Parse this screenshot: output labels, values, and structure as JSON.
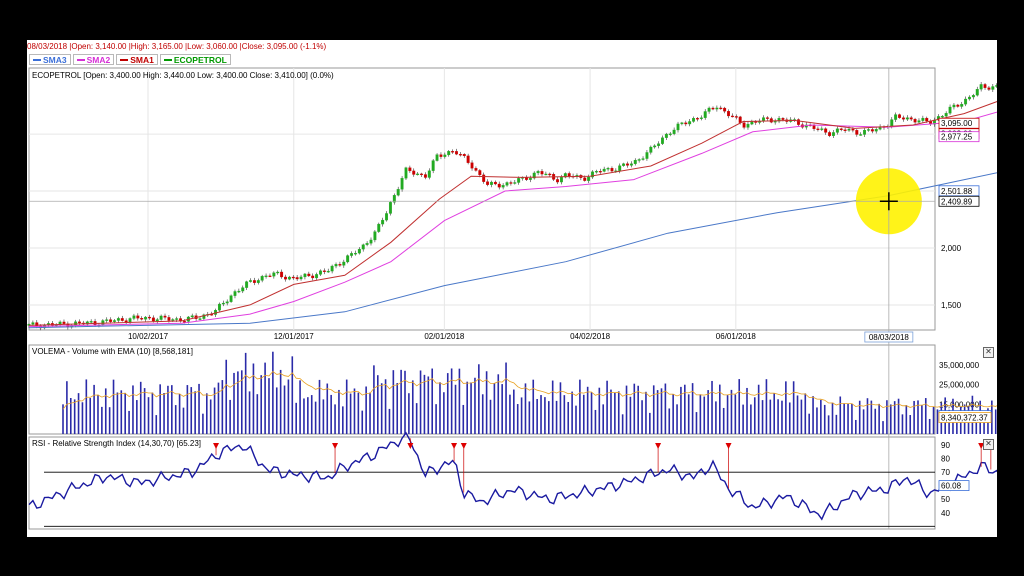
{
  "cursor_info": "08/03/2018 |Open: 3,140.00 |High: 3,165.00 |Low: 3,060.00 |Close: 3,095.00 (-1.1%)",
  "legend": [
    {
      "name": "SMA3",
      "color": "#3b6fd8"
    },
    {
      "name": "SMA2",
      "color": "#d62fd6"
    },
    {
      "name": "SMA1",
      "color": "#c00000"
    },
    {
      "name": "ECOPETROL",
      "color": "#009900"
    }
  ],
  "colors": {
    "up": "#22aa22",
    "down": "#cc0000",
    "sma3": "#4a78c8",
    "sma2": "#e040e0",
    "sma1": "#c03030",
    "volume": "#2a2aa8",
    "ema": "#e8a020",
    "rsi": "#1a1aa0",
    "crosshair": "#aaaaaa",
    "highlight": "#fff200"
  },
  "chart_data": [
    {
      "type": "candlestick",
      "title": "ECOPETROL [Open: 3,400.00  High: 3,440.00  Low: 3,400.00  Close: 3,410.00] (0.0%)",
      "x_ticks": [
        "10/02/2017",
        "12/01/2017",
        "02/01/2018",
        "04/02/2018",
        "06/01/2018"
      ],
      "cursor_x_label": "08/03/2018",
      "y_ticks": [
        1500,
        2000,
        2500,
        3000
      ],
      "ylim": [
        1280,
        3580
      ],
      "x_range": [
        "2017-08-14",
        "2018-08-22"
      ],
      "value_labels": [
        {
          "text": "3,095.00",
          "value": 3095,
          "color": "#c00000"
        },
        {
          "text": "3,003.00",
          "value": 3003,
          "color": "#c00000"
        },
        {
          "text": "2,977.25",
          "value": 2977,
          "color": "#d62fd6"
        },
        {
          "text": "2,501.88",
          "value": 2502,
          "color": "#3b6fd8"
        },
        {
          "text": "2,409.89",
          "value": 2410,
          "color": "#000000"
        }
      ],
      "price_keypoints": [
        [
          "2017-08-14",
          1320
        ],
        [
          "2017-08-28",
          1330
        ],
        [
          "2017-09-11",
          1345
        ],
        [
          "2017-09-25",
          1380
        ],
        [
          "2017-10-02",
          1385
        ],
        [
          "2017-10-16",
          1370
        ],
        [
          "2017-10-23",
          1390
        ],
        [
          "2017-10-30",
          1450
        ],
        [
          "2017-11-06",
          1600
        ],
        [
          "2017-11-13",
          1700
        ],
        [
          "2017-11-20",
          1760
        ],
        [
          "2017-11-24",
          1770
        ],
        [
          "2017-12-01",
          1730
        ],
        [
          "2017-12-08",
          1760
        ],
        [
          "2017-12-15",
          1800
        ],
        [
          "2017-12-22",
          1900
        ],
        [
          "2017-12-29",
          2000
        ],
        [
          "2018-01-04",
          2150
        ],
        [
          "2018-01-08",
          2300
        ],
        [
          "2018-01-10",
          2400
        ],
        [
          "2018-01-16",
          2680
        ],
        [
          "2018-01-24",
          2630
        ],
        [
          "2018-01-29",
          2800
        ],
        [
          "2018-02-05",
          2860
        ],
        [
          "2018-02-12",
          2730
        ],
        [
          "2018-02-19",
          2550
        ],
        [
          "2018-02-26",
          2560
        ],
        [
          "2018-03-05",
          2600
        ],
        [
          "2018-03-12",
          2670
        ],
        [
          "2018-03-19",
          2600
        ],
        [
          "2018-03-23",
          2640
        ],
        [
          "2018-03-30",
          2610
        ],
        [
          "2018-04-06",
          2680
        ],
        [
          "2018-04-13",
          2700
        ],
        [
          "2018-04-20",
          2750
        ],
        [
          "2018-04-27",
          2860
        ],
        [
          "2018-05-04",
          3010
        ],
        [
          "2018-05-11",
          3100
        ],
        [
          "2018-05-18",
          3160
        ],
        [
          "2018-05-24",
          3250
        ],
        [
          "2018-05-28",
          3190
        ],
        [
          "2018-06-04",
          3080
        ],
        [
          "2018-06-11",
          3120
        ],
        [
          "2018-06-18",
          3130
        ],
        [
          "2018-06-25",
          3110
        ],
        [
          "2018-07-02",
          3060
        ],
        [
          "2018-07-09",
          3010
        ],
        [
          "2018-07-16",
          3040
        ],
        [
          "2018-07-23",
          3010
        ],
        [
          "2018-07-30",
          3050
        ],
        [
          "2018-08-03",
          3095
        ],
        [
          "2018-08-06",
          3150
        ],
        [
          "2018-08-13",
          3130
        ],
        [
          "2018-08-20",
          3100
        ],
        [
          "2018-08-27",
          3200
        ],
        [
          "2018-09-03",
          3290
        ],
        [
          "2018-09-10",
          3410
        ],
        [
          "2018-09-17",
          3420
        ],
        [
          "2018-09-21",
          3410
        ]
      ],
      "sma1_keypoints": [
        [
          "2017-08-14",
          1320
        ],
        [
          "2017-10-16",
          1360
        ],
        [
          "2017-11-13",
          1500
        ],
        [
          "2017-12-01",
          1680
        ],
        [
          "2017-12-22",
          1760
        ],
        [
          "2018-01-10",
          2050
        ],
        [
          "2018-01-30",
          2430
        ],
        [
          "2018-02-12",
          2630
        ],
        [
          "2018-03-05",
          2620
        ],
        [
          "2018-04-02",
          2630
        ],
        [
          "2018-04-27",
          2720
        ],
        [
          "2018-05-18",
          2920
        ],
        [
          "2018-06-04",
          3110
        ],
        [
          "2018-06-25",
          3120
        ],
        [
          "2018-07-20",
          3050
        ],
        [
          "2018-08-13",
          3080
        ],
        [
          "2018-09-03",
          3180
        ],
        [
          "2018-09-21",
          3320
        ]
      ],
      "sma2_keypoints": [
        [
          "2017-08-14",
          1310
        ],
        [
          "2017-10-16",
          1340
        ],
        [
          "2017-11-13",
          1420
        ],
        [
          "2017-12-01",
          1530
        ],
        [
          "2017-12-22",
          1700
        ],
        [
          "2018-01-10",
          1880
        ],
        [
          "2018-02-01",
          2240
        ],
        [
          "2018-02-26",
          2500
        ],
        [
          "2018-03-23",
          2540
        ],
        [
          "2018-04-20",
          2600
        ],
        [
          "2018-05-18",
          2830
        ],
        [
          "2018-06-08",
          3020
        ],
        [
          "2018-07-02",
          3080
        ],
        [
          "2018-08-03",
          3060
        ],
        [
          "2018-09-03",
          3110
        ],
        [
          "2018-09-21",
          3220
        ]
      ],
      "sma3_keypoints": [
        [
          "2017-08-14",
          1300
        ],
        [
          "2017-11-13",
          1340
        ],
        [
          "2017-12-22",
          1440
        ],
        [
          "2018-02-01",
          1670
        ],
        [
          "2018-03-23",
          1880
        ],
        [
          "2018-05-04",
          2130
        ],
        [
          "2018-06-18",
          2310
        ],
        [
          "2018-08-03",
          2460
        ],
        [
          "2018-09-21",
          2680
        ]
      ],
      "x_cursor": "2018-08-03",
      "y_cursor": 2410
    },
    {
      "type": "bar",
      "title": "VOLEMA - Volume with EMA (10) [8,568,181]",
      "y_ticks_labels": [
        {
          "text": "35,000,000",
          "value": 35000000
        },
        {
          "text": "25,000,000",
          "value": 25000000
        },
        {
          "text": "15,000,000",
          "value": 15000000
        }
      ],
      "value_labels": [
        {
          "text": "9,299,253",
          "value": 9299253,
          "color": "#3b6fd8"
        },
        {
          "text": "8,340,372.37",
          "value": 8340372,
          "color": "#e8a020"
        }
      ],
      "ylim": [
        0,
        45000000
      ]
    },
    {
      "type": "line",
      "title": "RSI - Relative Strength Index (14,30,70) [65.23]",
      "y_ticks": [
        40,
        50,
        60,
        70,
        80,
        90
      ],
      "ylim": [
        28,
        96
      ],
      "value_label": {
        "text": "60.08",
        "value": 60.08
      },
      "overbought": 70,
      "oversold": 30,
      "rsi_keypoints": [
        [
          "2017-08-14",
          44
        ],
        [
          "2017-09-01",
          58
        ],
        [
          "2017-09-15",
          67
        ],
        [
          "2017-09-29",
          62
        ],
        [
          "2017-10-09",
          66
        ],
        [
          "2017-10-20",
          70
        ],
        [
          "2017-11-01",
          85
        ],
        [
          "2017-11-10",
          90
        ],
        [
          "2017-11-20",
          72
        ],
        [
          "2017-12-01",
          68
        ],
        [
          "2017-12-15",
          66
        ],
        [
          "2017-12-22",
          74
        ],
        [
          "2018-01-04",
          84
        ],
        [
          "2018-01-12",
          93
        ],
        [
          "2018-01-18",
          95
        ],
        [
          "2018-01-24",
          68
        ],
        [
          "2018-01-30",
          74
        ],
        [
          "2018-02-05",
          78
        ],
        [
          "2018-02-09",
          55
        ],
        [
          "2018-02-16",
          48
        ],
        [
          "2018-03-01",
          57
        ],
        [
          "2018-03-16",
          50
        ],
        [
          "2018-04-02",
          56
        ],
        [
          "2018-04-16",
          62
        ],
        [
          "2018-05-04",
          72
        ],
        [
          "2018-05-15",
          66
        ],
        [
          "2018-05-22",
          76
        ],
        [
          "2018-05-29",
          58
        ],
        [
          "2018-06-08",
          44
        ],
        [
          "2018-06-22",
          52
        ],
        [
          "2018-07-06",
          38
        ],
        [
          "2018-07-20",
          54
        ],
        [
          "2018-08-03",
          58
        ],
        [
          "2018-08-10",
          66
        ],
        [
          "2018-08-20",
          54
        ],
        [
          "2018-08-31",
          64
        ],
        [
          "2018-09-10",
          74
        ],
        [
          "2018-09-14",
          72
        ],
        [
          "2018-09-21",
          66
        ]
      ],
      "signal_dates": [
        "2017-10-30",
        "2017-12-18",
        "2018-01-18",
        "2018-02-05",
        "2018-02-09",
        "2018-04-30",
        "2018-05-29",
        "2018-09-10",
        "2018-09-14"
      ]
    }
  ],
  "close_icon_glyph": "✕"
}
